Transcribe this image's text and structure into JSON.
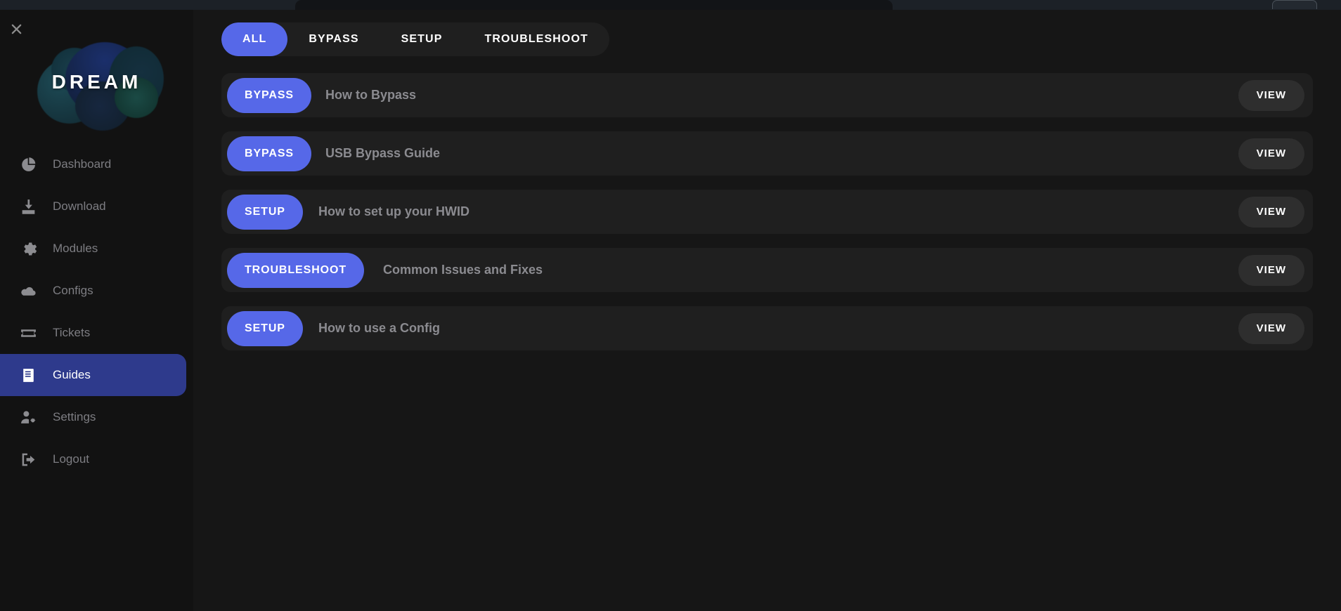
{
  "window": {
    "chrome_visible": true
  },
  "sidebar": {
    "close_icon": "close-icon",
    "logo_text": "DREAM",
    "active_item": "Guides",
    "items": [
      {
        "label": "Dashboard",
        "icon": "pie-chart-icon",
        "active": false
      },
      {
        "label": "Download",
        "icon": "download-icon",
        "active": false
      },
      {
        "label": "Modules",
        "icon": "gear-icon",
        "active": false
      },
      {
        "label": "Configs",
        "icon": "cloud-icon",
        "active": false
      },
      {
        "label": "Tickets",
        "icon": "ticket-icon",
        "active": false
      },
      {
        "label": "Guides",
        "icon": "book-icon",
        "active": true
      },
      {
        "label": "Settings",
        "icon": "user-gear-icon",
        "active": false
      },
      {
        "label": "Logout",
        "icon": "logout-icon",
        "active": false
      }
    ]
  },
  "main": {
    "tabs": [
      {
        "label": "ALL",
        "active": true
      },
      {
        "label": "BYPASS",
        "active": false
      },
      {
        "label": "SETUP",
        "active": false
      },
      {
        "label": "TROUBLESHOOT",
        "active": false
      }
    ],
    "view_label": "VIEW",
    "guides": [
      {
        "category": "BYPASS",
        "title": "How to Bypass",
        "action": "VIEW"
      },
      {
        "category": "BYPASS",
        "title": "USB Bypass Guide",
        "action": "VIEW"
      },
      {
        "category": "SETUP",
        "title": "How to set up your HWID",
        "action": "VIEW"
      },
      {
        "category": "TROUBLESHOOT",
        "title": "Common Issues and Fixes",
        "action": "VIEW"
      },
      {
        "category": "SETUP",
        "title": "How to use a Config",
        "action": "VIEW"
      }
    ]
  },
  "colors": {
    "accent": "#5668e8",
    "sidebar_active": "#2e3a8c",
    "card": "#1f1f1f",
    "sidebar_bg": "#121212",
    "main_bg": "#161616"
  }
}
